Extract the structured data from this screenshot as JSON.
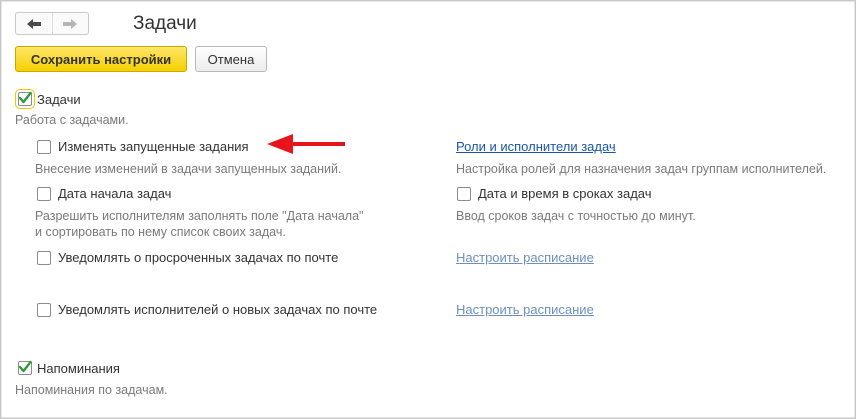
{
  "header": {
    "title": "Задачи",
    "back_icon": "arrow-left-icon",
    "forward_icon": "arrow-right-icon"
  },
  "toolbar": {
    "save_label": "Сохранить настройки",
    "cancel_label": "Отмена"
  },
  "tasks_section": {
    "checkbox_label": "Задачи",
    "checked": true,
    "description": "Работа с задачами."
  },
  "left_options": [
    {
      "label": "Изменять запущенные задания",
      "checked": false,
      "hint": "Внесение изменений в задачи запущенных заданий."
    },
    {
      "label": "Дата начала задач",
      "checked": false,
      "hint_line1": "Разрешить исполнителям заполнять поле \"Дата начала\"",
      "hint_line2": "и сортировать по нему список своих задач."
    },
    {
      "label": "Уведомлять о просроченных задачах по почте",
      "checked": false
    },
    {
      "label": "Уведомлять исполнителей о новых задачах по почте",
      "checked": false
    }
  ],
  "right_options": {
    "roles_link": "Роли и исполнители задач",
    "roles_hint": "Настройка ролей для назначения задач группам исполнителей.",
    "datetime_label": "Дата и время в сроках задач",
    "datetime_checked": false,
    "datetime_hint": "Ввод сроков задач с точностью до минут.",
    "schedule_link_1": "Настроить расписание",
    "schedule_link_2": "Настроить расписание"
  },
  "reminders": {
    "checkbox_label": "Напоминания",
    "checked": true,
    "description": "Напоминания по задачам."
  },
  "colors": {
    "accent_yellow": "#f5d000",
    "link_blue": "#1a55a8",
    "check_green": "#2e9b3a",
    "annotation_red": "#e8141c"
  },
  "annotation": {
    "icon": "red-arrow-icon"
  }
}
